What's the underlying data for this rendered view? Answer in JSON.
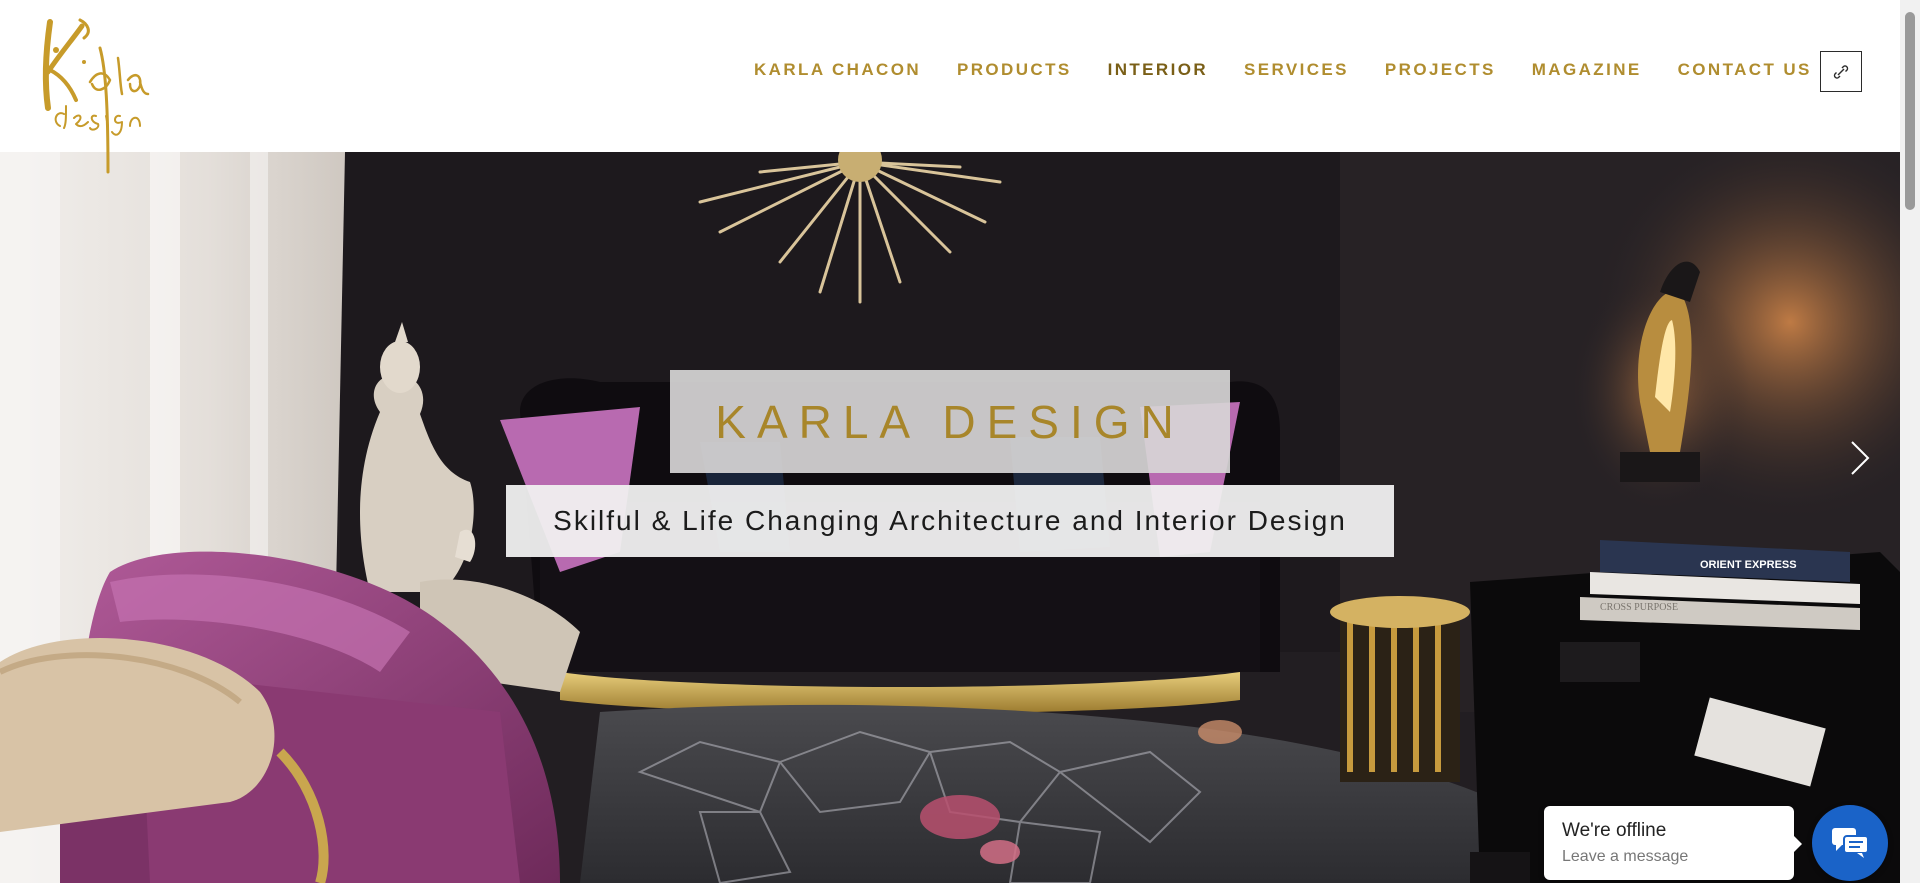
{
  "brand": {
    "logo_text": "Karla design"
  },
  "nav": {
    "items": [
      {
        "label": "KARLA CHACON"
      },
      {
        "label": "PRODUCTS"
      },
      {
        "label": "INTERIOR"
      },
      {
        "label": "SERVICES"
      },
      {
        "label": "PROJECTS"
      },
      {
        "label": "MAGAZINE"
      },
      {
        "label": "CONTACT US"
      }
    ],
    "active_item": "INTERIOR",
    "icon": "link-icon"
  },
  "hero": {
    "title": "KARLA DESIGN",
    "subtitle": "Skilful & Life Changing Architecture and Interior Design",
    "next_icon": "chevron-right-icon",
    "books": {
      "book1": "ORIENT EXPRESS",
      "book2": "CROSS PURPOSE"
    }
  },
  "chat": {
    "status": "We're offline",
    "hint": "Leave a message",
    "icon": "chat-icon"
  },
  "colors": {
    "gold": "#b08d2f",
    "gold_active": "#7a5f17",
    "title_gold": "#a8862a",
    "chat_blue": "#1a63c8"
  }
}
